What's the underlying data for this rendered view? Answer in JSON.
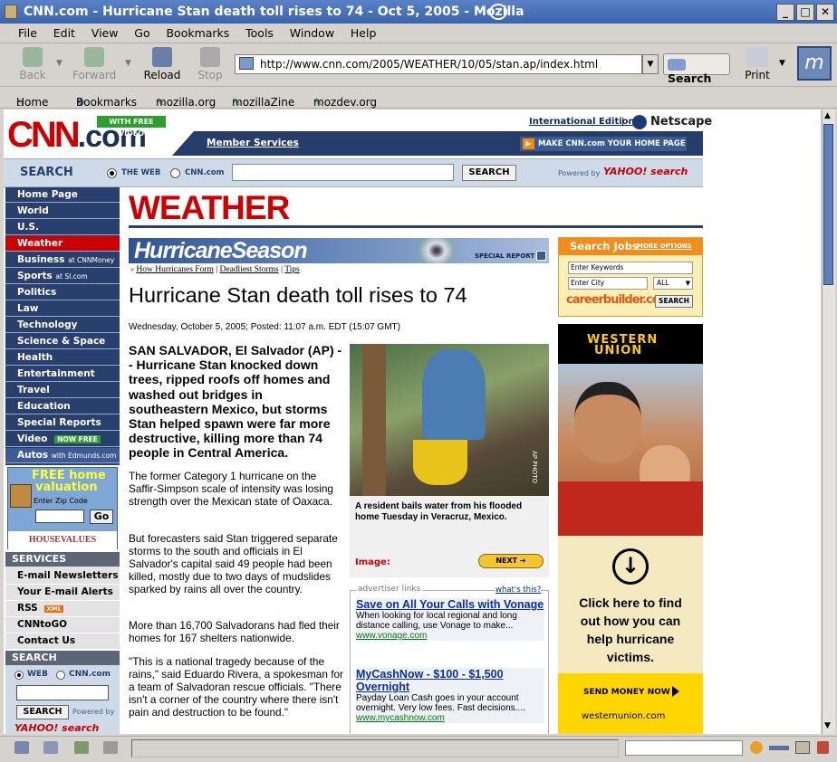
{
  "window": {
    "title": "CNN.com - Hurricane Stan death toll rises to 74 - Oct 5, 2005 - Mozilla"
  },
  "menu": [
    "File",
    "Edit",
    "View",
    "Go",
    "Bookmarks",
    "Tools",
    "Window",
    "Help"
  ],
  "nav": {
    "back": "Back",
    "forward": "Forward",
    "reload": "Reload",
    "stop": "Stop",
    "search": "Search",
    "print": "Print",
    "url": "http://www.cnn.com/2005/WEATHER/10/05/stan.ap/index.html"
  },
  "bookmarks": [
    "Home",
    "Bookmarks",
    "mozilla.org",
    "mozillaZine",
    "mozdev.org"
  ],
  "header": {
    "free_video": "WITH FREE VIDEO",
    "intl": "International Edition",
    "netscape": "Netscape",
    "member": "Member Services",
    "homepage": "MAKE CNN.com YOUR HOME PAGE",
    "search_label": "SEARCH",
    "radio_web": "THE WEB",
    "radio_cnn": "CNN.com",
    "search_btn": "SEARCH",
    "powered": "Powered by",
    "yahoo": "YAHOO! search"
  },
  "sidebar": {
    "items": [
      {
        "label": "Home Page",
        "sub": ""
      },
      {
        "label": "World",
        "sub": ""
      },
      {
        "label": "U.S.",
        "sub": ""
      },
      {
        "label": "Weather",
        "sub": ""
      },
      {
        "label": "Business",
        "sub": "at CNNMoney"
      },
      {
        "label": "Sports",
        "sub": "at SI.com"
      },
      {
        "label": "Politics",
        "sub": ""
      },
      {
        "label": "Law",
        "sub": ""
      },
      {
        "label": "Technology",
        "sub": ""
      },
      {
        "label": "Science & Space",
        "sub": ""
      },
      {
        "label": "Health",
        "sub": ""
      },
      {
        "label": "Entertainment",
        "sub": ""
      },
      {
        "label": "Travel",
        "sub": ""
      },
      {
        "label": "Education",
        "sub": ""
      },
      {
        "label": "Special Reports",
        "sub": ""
      },
      {
        "label": "Video",
        "sub": "NOW FREE"
      },
      {
        "label": "Autos",
        "sub": "with Edmunds.com"
      }
    ],
    "home_ad": {
      "line1": "FREE home",
      "line2": "valuation",
      "zip_label": "Enter Zip Code",
      "go": "Go",
      "brand": "HOUSEVALUES"
    },
    "services_title": "SERVICES",
    "services": [
      "E-mail Newsletters",
      "Your E-mail Alerts",
      "RSS",
      "CNNtoGO",
      "Contact Us"
    ],
    "rss_badge": "XML",
    "search_title": "SEARCH",
    "search_web": "WEB",
    "search_cnn": "CNN.com",
    "search_btn": "SEARCH",
    "powered": "Powered by",
    "yahoo": "YAHOO! search"
  },
  "section": "WEATHER",
  "banner": {
    "title": "HurricaneSeason",
    "special": "SPECIAL REPORT",
    "links": [
      "How Hurricanes Form",
      "Deadliest Storms",
      "Tips"
    ]
  },
  "article": {
    "headline": "Hurricane Stan death toll rises to 74",
    "dateline": "Wednesday, October 5, 2005; Posted: 11:07 a.m. EDT (15:07 GMT)",
    "lead": "SAN SALVADOR, El Salvador (AP) -- Hurricane Stan knocked down trees, ripped roofs off homes and washed out bridges in southeastern Mexico, but storms Stan helped spawn were far more destructive, killing more than 74 people in Central America.",
    "paragraphs": [
      "The former Category 1 hurricane on the Saffir-Simpson scale of intensity was losing strength over the Mexican state of Oaxaca.",
      "But forecasters said Stan triggered separate storms to the south and officials in El Salvador's capital said 49 people had been killed, mostly due to two days of mudslides sparked by rains all over the country.",
      "More than 16,700 Salvadorans had fled their homes for 167 shelters nationwide.",
      "\"This is a national tragedy because of the rains,\" said Eduardo Rivera, a spokesman for a team of Salvadoran rescue officials. \"There isn't a corner of the country where there isn't pain and destruction to be found.\""
    ]
  },
  "photo": {
    "credit": "AP PHOTO",
    "caption": "A resident bails water from his flooded home Tuesday in Veracruz, Mexico.",
    "image_label": "Image:",
    "next": "NEXT"
  },
  "adlinks": {
    "title": "advertiser links",
    "whats": "what's this?",
    "items": [
      {
        "head": "Save on All Your Calls with Vonage",
        "text": "When looking for local regional and long distance calling, use Vonage to make...",
        "url": "www.vonage.com"
      },
      {
        "head": "MyCashNow - $100 - $1,500 Overnight",
        "text": "Payday Loan Cash goes in your account overnight. Very low fees. Fast decisions....",
        "url": "www.mycashnow.com"
      }
    ]
  },
  "jobs": {
    "title": "Search Jobs",
    "more": "MORE OPTIONS",
    "keywords": "Enter Keywords",
    "city": "Enter City",
    "all": "ALL",
    "brand": "careerbuilder.com",
    "search": "SEARCH"
  },
  "wu": {
    "brand1": "WESTERN",
    "brand2": "UNION",
    "text": "Click here to find out how you can help hurricane victims.",
    "send": "SEND MONEY NOW",
    "url": "westernunion.com"
  },
  "colors": {
    "navy": "#29406f",
    "red": "#cc0000",
    "accent": "#ff8800"
  }
}
